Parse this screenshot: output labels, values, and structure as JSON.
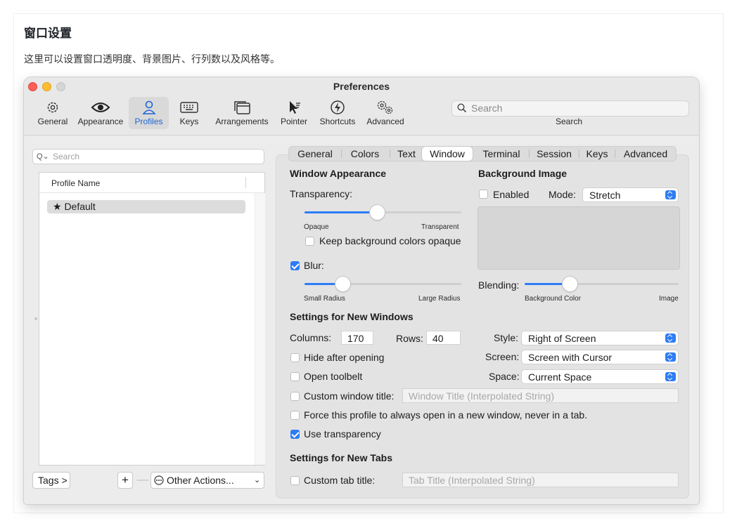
{
  "doc": {
    "title": "窗口设置",
    "description": "这里可以设置窗口透明度、背景图片、行列数以及风格等。"
  },
  "window": {
    "title": "Preferences"
  },
  "toolbar": {
    "items": [
      {
        "label": "General",
        "icon": "gear-icon"
      },
      {
        "label": "Appearance",
        "icon": "eye-icon"
      },
      {
        "label": "Profiles",
        "icon": "person-icon"
      },
      {
        "label": "Keys",
        "icon": "keyboard-icon"
      },
      {
        "label": "Arrangements",
        "icon": "windows-icon"
      },
      {
        "label": "Pointer",
        "icon": "cursor-icon"
      },
      {
        "label": "Shortcuts",
        "icon": "bolt-icon"
      },
      {
        "label": "Advanced",
        "icon": "gears-icon"
      }
    ],
    "active": "Profiles",
    "search_placeholder": "Search",
    "search_caption": "Search"
  },
  "profiles": {
    "search_placeholder": "Search",
    "column_header": "Profile Name",
    "rows": [
      "★ Default"
    ],
    "tags_button": "Tags >",
    "add_label": "+",
    "remove_label": "—",
    "other_actions": "Other Actions..."
  },
  "tabs": {
    "items": [
      "General",
      "Colors",
      "Text",
      "Window",
      "Terminal",
      "Session",
      "Keys",
      "Advanced"
    ],
    "selected": "Window"
  },
  "window_appearance": {
    "heading": "Window Appearance",
    "transparency_label": "Transparency:",
    "transparency_value": 0.46,
    "transparency_min": "Opaque",
    "transparency_max": "Transparent",
    "keep_bg_opaque": {
      "label": "Keep background colors opaque",
      "checked": false
    },
    "blur": {
      "label": "Blur:",
      "checked": true
    },
    "blur_value": 0.24,
    "blur_min": "Small Radius",
    "blur_max": "Large Radius"
  },
  "background_image": {
    "heading": "Background Image",
    "enabled": {
      "label": "Enabled",
      "checked": false
    },
    "mode_label": "Mode:",
    "mode_value": "Stretch",
    "blending_label": "Blending:",
    "blending_value": 0.29,
    "blending_min": "Background Color",
    "blending_max": "Image"
  },
  "new_windows": {
    "heading": "Settings for New Windows",
    "columns_label": "Columns:",
    "columns_value": "170",
    "rows_label": "Rows:",
    "rows_value": "40",
    "style_label": "Style:",
    "style_value": "Right of Screen",
    "screen_label": "Screen:",
    "screen_value": "Screen with Cursor",
    "space_label": "Space:",
    "space_value": "Current Space",
    "hide_after_opening": {
      "label": "Hide after opening",
      "checked": false
    },
    "open_toolbelt": {
      "label": "Open toolbelt",
      "checked": false
    },
    "custom_window_title": {
      "label": "Custom window title:",
      "checked": false,
      "placeholder": "Window Title (Interpolated String)"
    },
    "force_new_window": {
      "label": "Force this profile to always open in a new window, never in a tab.",
      "checked": false
    },
    "use_transparency": {
      "label": "Use transparency",
      "checked": true
    }
  },
  "new_tabs": {
    "heading": "Settings for New Tabs",
    "custom_tab_title": {
      "label": "Custom tab title:",
      "checked": false,
      "placeholder": "Tab Title (Interpolated String)"
    }
  },
  "colors": {
    "accent": "#2d7cf6",
    "active_tab_text": "#1a66d6",
    "close": "#fe5f57",
    "minimize": "#febc2e",
    "inactive": "#d5d5d5"
  }
}
